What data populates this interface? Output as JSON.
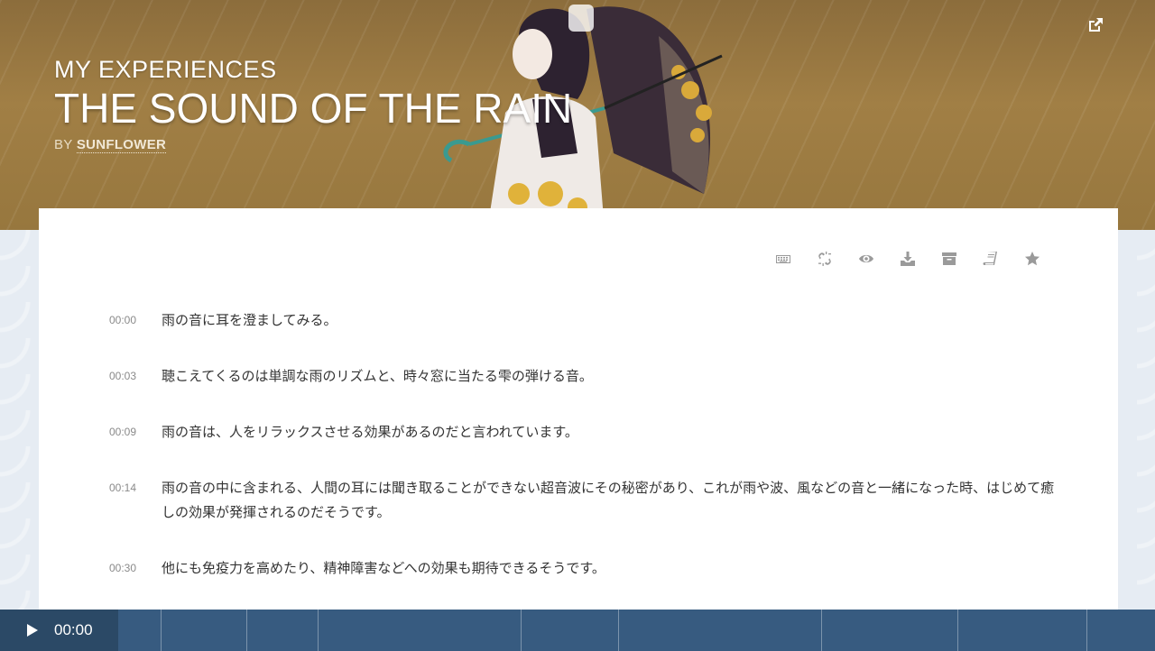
{
  "hero": {
    "kicker": "MY EXPERIENCES",
    "title": "THE SOUND OF THE RAIN",
    "byline_prefix": "BY",
    "author": "SUNFLOWER",
    "background_color": "#9a7a41"
  },
  "toolbar": {
    "icons": [
      "keyboard-icon",
      "unlink-icon",
      "eye-icon",
      "download-icon",
      "archive-icon",
      "book-icon",
      "star-icon"
    ]
  },
  "transcript": [
    {
      "time": "00:00",
      "text": "雨の音に耳を澄ましてみる。"
    },
    {
      "time": "00:03",
      "text": "聴こえてくるのは単調な雨のリズムと、時々窓に当たる雫の弾ける音。"
    },
    {
      "time": "00:09",
      "text": "雨の音は、人をリラックスさせる効果があるのだと言われています。"
    },
    {
      "time": "00:14",
      "text": "雨の音の中に含まれる、人間の耳には聞き取ることができない超音波にその秘密があり、これが雨や波、風などの音と一緒になった時、はじめて癒しの効果が発揮されるのだそうです。"
    },
    {
      "time": "00:30",
      "text": "他にも免疫力を高めたり、精神障害などへの効果も期待できるそうです。"
    }
  ],
  "player": {
    "current_time": "00:00",
    "bar_color": "#375b80",
    "play_section_color": "#2b4966"
  }
}
